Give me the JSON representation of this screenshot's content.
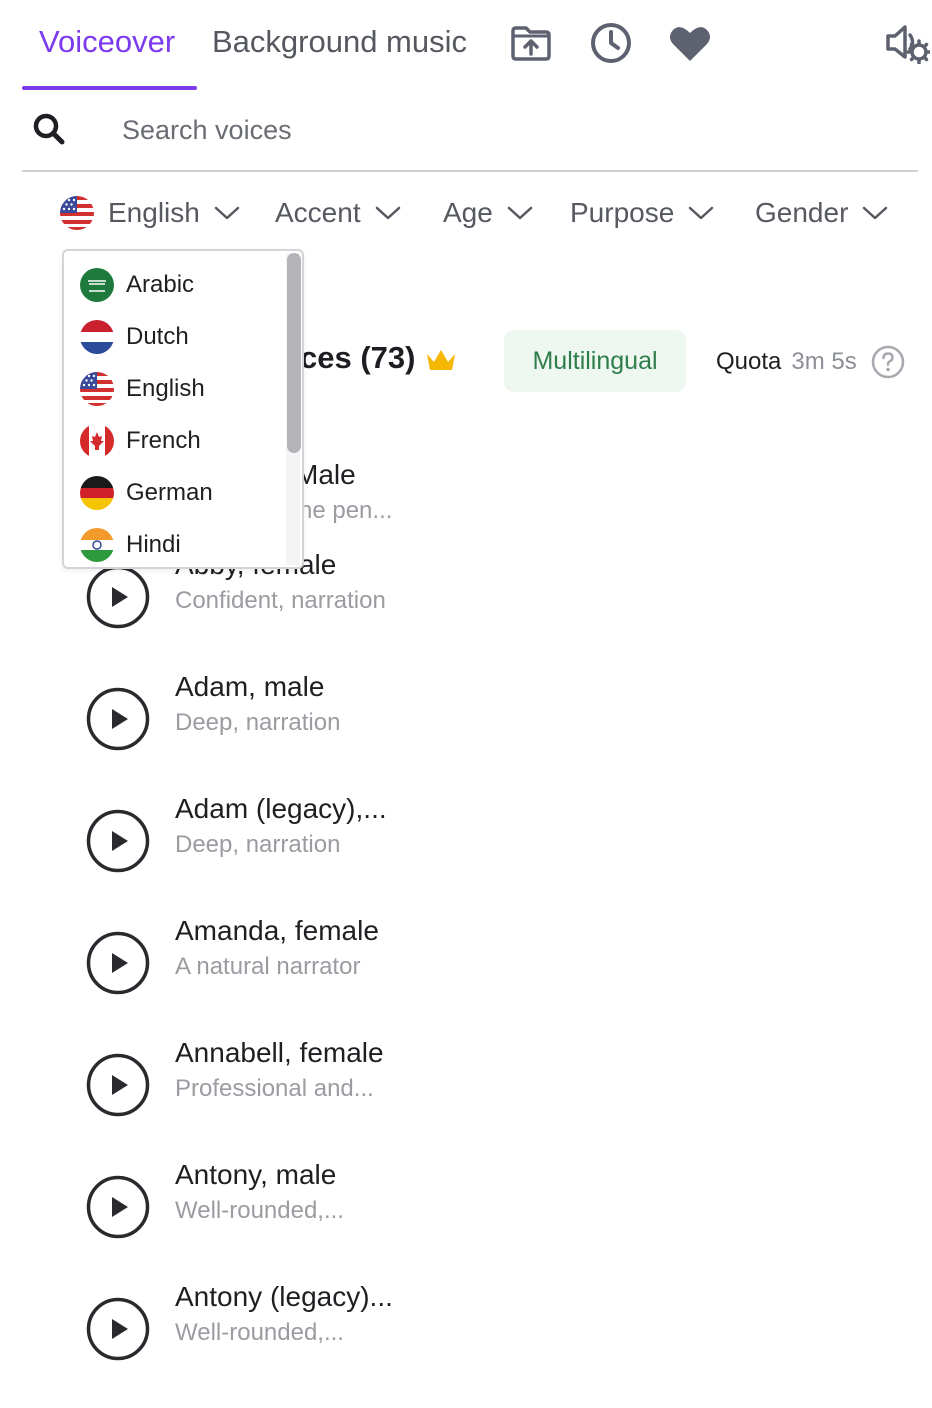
{
  "tabs": {
    "voiceover": "Voiceover",
    "background_music": "Background music"
  },
  "icons": {
    "upload": "folder-upload-icon",
    "history": "clock-icon",
    "favorites": "heart-icon",
    "audio_settings": "speaker-gear-icon"
  },
  "search": {
    "placeholder": "Search voices"
  },
  "filters": {
    "language": "English",
    "accent": "Accent",
    "age": "Age",
    "purpose": "Purpose",
    "gender": "Gender"
  },
  "header": {
    "title_visible": "ces (73)",
    "multilingual": "Multilingual",
    "quota_label": "Quota",
    "quota_value": "3m 5s"
  },
  "language_dropdown": {
    "options": [
      "Arabic",
      "Dutch",
      "English",
      "French",
      "German",
      "Hindi"
    ],
    "scroll_position": 0.0
  },
  "voices": [
    {
      "name": "Male",
      "desc": "he pen..."
    },
    {
      "name": "Abby, female",
      "desc": "Confident, narration"
    },
    {
      "name": "Adam, male",
      "desc": "Deep, narration"
    },
    {
      "name": "Adam (legacy),...",
      "desc": "Deep, narration"
    },
    {
      "name": "Amanda, female",
      "desc": "A natural narrator"
    },
    {
      "name": "Annabell, female",
      "desc": "Professional and..."
    },
    {
      "name": "Antony, male",
      "desc": "Well-rounded,..."
    },
    {
      "name": "Antony (legacy)...",
      "desc": "Well-rounded,..."
    }
  ],
  "colors": {
    "accent": "#7c3aed",
    "icon": "#5e6170",
    "multilingual_bg": "#eef8f1",
    "multilingual_text": "#2e7d4a",
    "crown": "#f5b800"
  }
}
